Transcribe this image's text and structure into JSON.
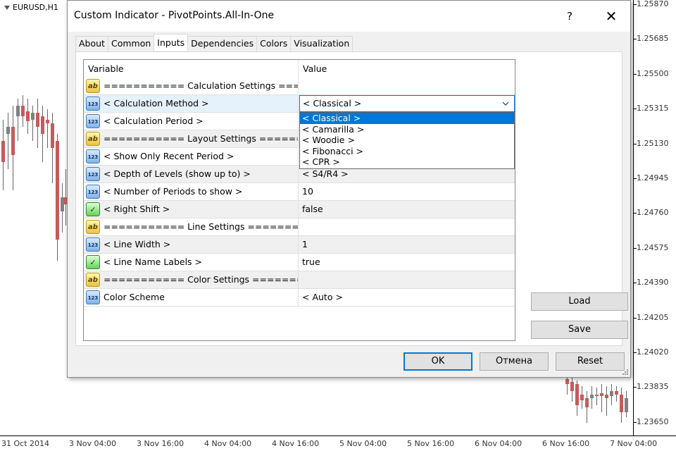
{
  "chart": {
    "symbol": "EURUSD,H1",
    "price_labels": [
      "1.25870",
      "1.25685",
      "1.25500",
      "1.25315",
      "1.25130",
      "1.24945",
      "1.24760",
      "1.24575",
      "1.24390",
      "1.24205",
      "1.24020",
      "1.23835",
      "1.23650"
    ],
    "time_labels": [
      "31 Oct 2014",
      "3 Nov 04:00",
      "3 Nov 16:00",
      "4 Nov 04:00",
      "4 Nov 16:00",
      "5 Nov 04:00",
      "5 Nov 16:00",
      "6 Nov 04:00",
      "6 Nov 16:00",
      "7 Nov 04:00"
    ],
    "colors": {
      "bull": "#808080",
      "bear": "#c85a5a",
      "wick": "#666666"
    }
  },
  "dialog": {
    "title": "Custom Indicator - PivotPoints.All-In-One",
    "help": "?",
    "close": "✕",
    "tabs": [
      "About",
      "Common",
      "Inputs",
      "Dependencies",
      "Colors",
      "Visualization"
    ],
    "active_tab": "Inputs",
    "grid": {
      "headers": {
        "variable": "Variable",
        "value": "Value"
      },
      "rows": [
        {
          "icon": "ab",
          "variable": "=========== Calculation Settings ===========",
          "value": ""
        },
        {
          "icon": "123",
          "variable": "< Calculation Method >",
          "value": "< Classical >"
        },
        {
          "icon": "123",
          "variable": "< Calculation Period >",
          "value": ""
        },
        {
          "icon": "ab",
          "variable": "=========== Layout Settings ==============",
          "value": ""
        },
        {
          "icon": "123",
          "variable": "< Show Only Recent Period >",
          "value": ""
        },
        {
          "icon": "123",
          "variable": "< Depth of Levels (show up to) >",
          "value": "< S4/R4 >"
        },
        {
          "icon": "123",
          "variable": "< Number of Periods to show >",
          "value": "10"
        },
        {
          "icon": "bool",
          "variable": "< Right Shift >",
          "value": "false"
        },
        {
          "icon": "ab",
          "variable": "=========== Line Settings ==============",
          "value": ""
        },
        {
          "icon": "123",
          "variable": "< Line Width >",
          "value": "1"
        },
        {
          "icon": "bool",
          "variable": "< Line Name Labels >",
          "value": "true"
        },
        {
          "icon": "ab",
          "variable": "=========== Color Settings ===========",
          "value": ""
        },
        {
          "icon": "123",
          "variable": "Color Scheme",
          "value": "< Auto >"
        }
      ],
      "combo": {
        "value": "< Classical >",
        "options": [
          "< Classical >",
          "< Camarilla >",
          "< Woodie >",
          "< Fibonacci >",
          "< CPR >"
        ],
        "selected": "< Classical >"
      }
    },
    "buttons": {
      "load": "Load",
      "save": "Save",
      "ok": "OK",
      "cancel": "Отмена",
      "reset": "Reset"
    },
    "colors": {
      "accent": "#0078d7",
      "selected_row": "#e5f1fb",
      "alt_row": "#f0f0f0"
    }
  }
}
